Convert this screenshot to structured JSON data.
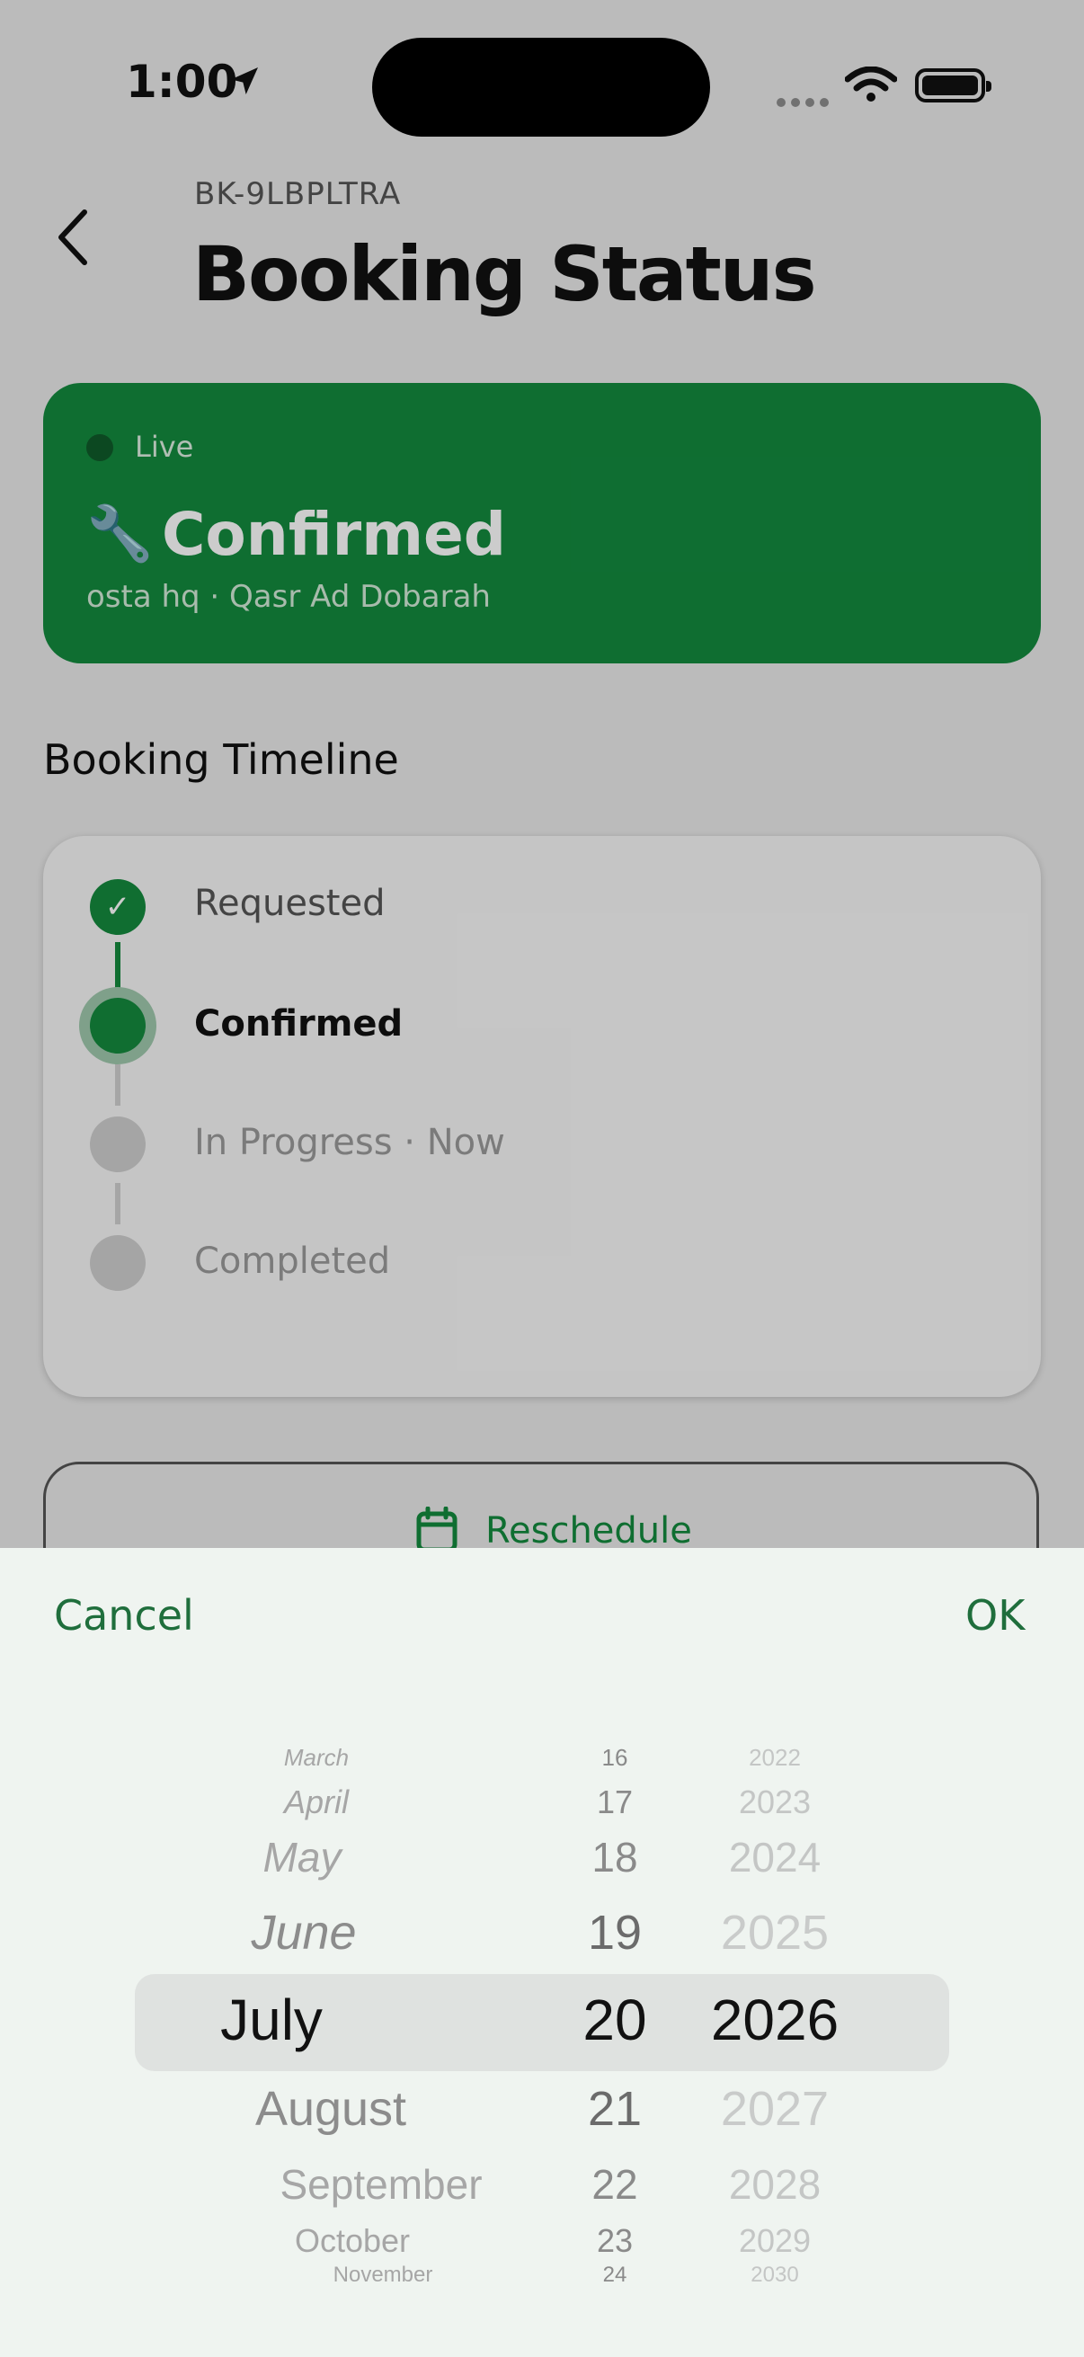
{
  "status_bar": {
    "time": "1:00"
  },
  "header": {
    "booking_id": "BK-9LBPLTRA",
    "title": "Booking Status"
  },
  "status_card": {
    "live_label": "Live",
    "icon": "🔧",
    "status": "Confirmed",
    "subtitle": "osta hq · Qasr Ad Dobarah"
  },
  "timeline": {
    "heading": "Booking Timeline",
    "steps": [
      {
        "label": "Requested",
        "state": "done"
      },
      {
        "label": "Confirmed",
        "state": "current"
      },
      {
        "label": "In Progress · Now",
        "state": "pending"
      },
      {
        "label": "Completed",
        "state": "pending"
      }
    ]
  },
  "reschedule_label": "Reschedule",
  "date_picker": {
    "cancel": "Cancel",
    "ok": "OK",
    "months": [
      "March",
      "April",
      "May",
      "June",
      "July",
      "August",
      "September",
      "October",
      "November"
    ],
    "days": [
      "16",
      "17",
      "18",
      "19",
      "20",
      "21",
      "22",
      "23",
      "24"
    ],
    "years": [
      "2022",
      "2023",
      "2024",
      "2025",
      "2026",
      "2027",
      "2028",
      "2029",
      "2030"
    ],
    "selected": {
      "month": "July",
      "day": "20",
      "year": "2026"
    }
  },
  "colors": {
    "brand_green": "#138a3e",
    "picker_accent": "#1f6e3c"
  }
}
